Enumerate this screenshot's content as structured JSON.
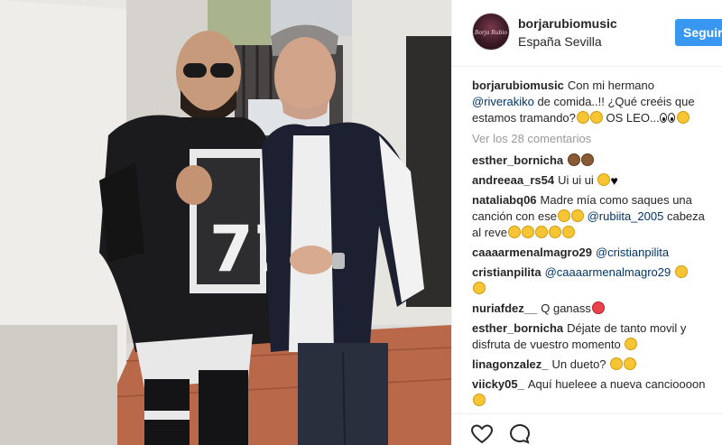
{
  "post": {
    "username": "borjarubiomusic",
    "location": "España Sevilla",
    "avatar_text": "Borja Rubio",
    "follow_label": "Seguir"
  },
  "caption": {
    "user": "borjarubiomusic",
    "text_1": "Con mi hermano",
    "mention": "@riverakiko",
    "text_2": "de comida..!! ¿Qué creéis que estamos tramando?",
    "text_3": "OS LEO...",
    "emojis": [
      "neutral-face-emoji",
      "zipper-mouth-emoji",
      "eyes-emoji",
      "grinning-emoji"
    ]
  },
  "view_all_label": "Ver los 28 comentarios",
  "comments": [
    {
      "user": "esther_bornicha",
      "text": "",
      "emojis": [
        "see-no-evil-monkey-emoji",
        "see-no-evil-monkey-emoji"
      ]
    },
    {
      "user": "andreeaa_rs54",
      "text": "Ui ui ui",
      "emojis": [
        "smirk-emoji",
        "black-heart-emoji"
      ]
    },
    {
      "user": "nataliabq06",
      "text_a": "Madre mía como saques una canción con ese",
      "mention": "@rubiita_2005",
      "text_b": "cabeza al reve",
      "emojis": [
        "rofl-emoji",
        "weary-emoji",
        "rofl-emoji"
      ]
    },
    {
      "user": "caaaarmenalmagro29",
      "mention": "@cristianpilita"
    },
    {
      "user": "cristianpilita",
      "mention": "@caaaarmenalmagro29",
      "emojis": [
        "grinning-squint-emoji",
        "rofl-emoji"
      ]
    },
    {
      "user": "nuriafdez__",
      "text": "Q ganass",
      "emojis": [
        "heart-eyes-emoji"
      ]
    },
    {
      "user": "esther_bornicha",
      "text": "Déjate de tanto movil y disfruta de vuestro momento",
      "emojis": [
        "smile-emoji"
      ]
    },
    {
      "user": "linagonzalez_",
      "text": "Un dueto?",
      "emojis": [
        "thinking-emoji",
        "sunglasses-emoji"
      ]
    },
    {
      "user": "viicky05_",
      "text": "Aquí hueleee a nueva cancioooon",
      "emojis": [
        "smile-emoji"
      ]
    }
  ],
  "actions": {
    "like_icon": "heart-outline-icon",
    "comment_icon": "comment-bubble-icon"
  },
  "colors": {
    "follow_button": "#3897f0",
    "mention": "#003569",
    "muted": "#999999",
    "text": "#262626"
  }
}
